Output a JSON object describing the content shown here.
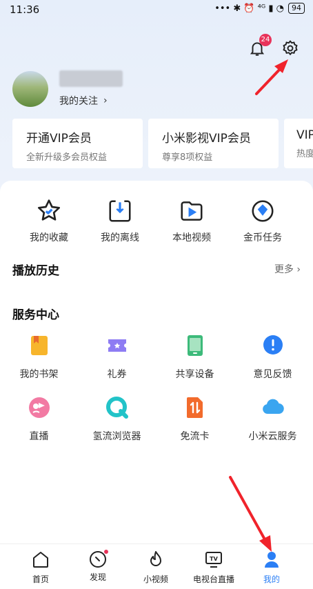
{
  "status_bar": {
    "time": "11:36",
    "indicators": "••• ✱ ⏰ ⁴ᴳ ▮ ◔",
    "battery": "94"
  },
  "header": {
    "notification_badge": "24"
  },
  "profile": {
    "follow_label": "我的关注",
    "chevron": "›"
  },
  "vip_cards": [
    {
      "title": "开通VIP会员",
      "subtitle": "全新升级多会员权益"
    },
    {
      "title": "小米影视VIP会员",
      "subtitle": "尊享8项权益"
    },
    {
      "title": "VIP",
      "subtitle": "热度"
    }
  ],
  "quick_actions": [
    {
      "label": "我的收藏",
      "icon": "star-icon"
    },
    {
      "label": "我的离线",
      "icon": "download-icon"
    },
    {
      "label": "本地视频",
      "icon": "folder-play-icon"
    },
    {
      "label": "金币任务",
      "icon": "coin-icon"
    }
  ],
  "history": {
    "title": "播放历史",
    "more": "更多 ›"
  },
  "services": {
    "title": "服务中心",
    "items": [
      {
        "label": "我的书架",
        "icon": "bookshelf-icon"
      },
      {
        "label": "礼券",
        "icon": "coupon-icon"
      },
      {
        "label": "共享设备",
        "icon": "tablet-icon"
      },
      {
        "label": "意见反馈",
        "icon": "feedback-icon"
      },
      {
        "label": "直播",
        "icon": "live-icon"
      },
      {
        "label": "氢流浏览器",
        "icon": "browser-icon"
      },
      {
        "label": "免流卡",
        "icon": "sim-card-icon"
      },
      {
        "label": "小米云服务",
        "icon": "cloud-icon"
      }
    ]
  },
  "tabbar": {
    "items": [
      {
        "label": "首页",
        "icon": "home-icon"
      },
      {
        "label": "发现",
        "icon": "compass-icon"
      },
      {
        "label": "小视频",
        "icon": "flame-icon"
      },
      {
        "label": "电视台直播",
        "icon": "tv-icon"
      },
      {
        "label": "我的",
        "icon": "profile-icon"
      }
    ],
    "active": "我的"
  },
  "colors": {
    "accent": "#2b7ff5",
    "badge": "#e8335a",
    "annotation_arrow": "#f0232b"
  }
}
